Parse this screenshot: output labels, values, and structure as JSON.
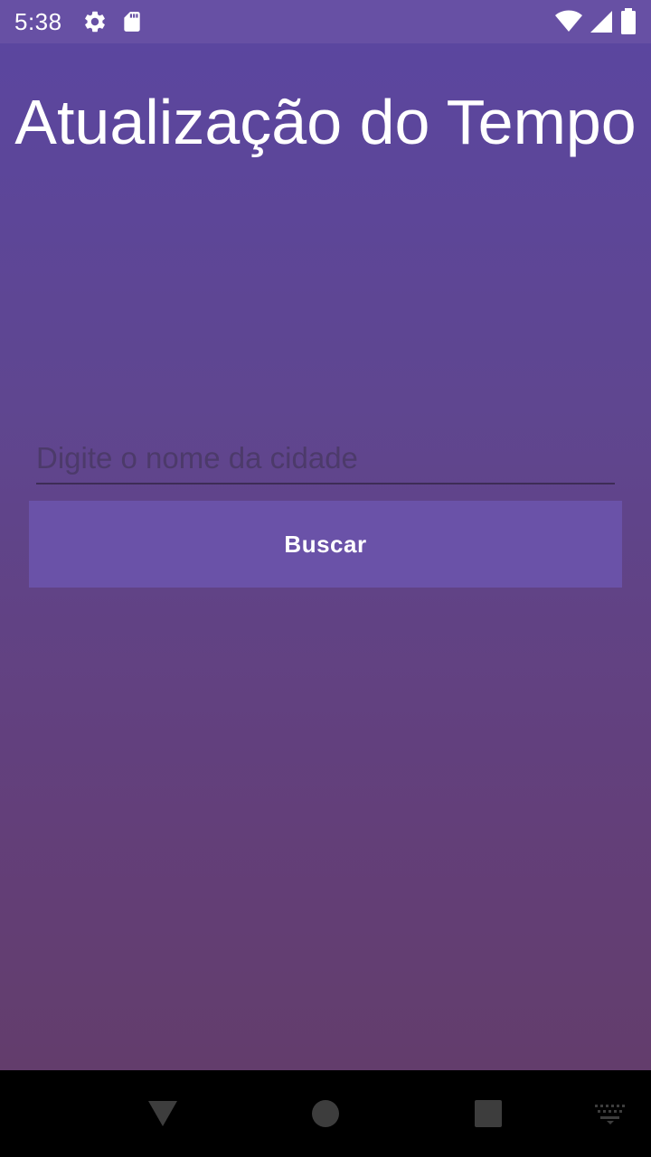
{
  "status_bar": {
    "time": "5:38",
    "left_icons": [
      "settings-icon",
      "sd-card-icon"
    ],
    "right_icons": [
      "wifi-icon",
      "signal-icon",
      "battery-icon"
    ]
  },
  "app": {
    "title": "Atualização do Tempo",
    "city_input": {
      "value": "",
      "placeholder": "Digite o nome da cidade"
    },
    "search_button_label": "Buscar"
  },
  "nav_bar": {
    "buttons": [
      "back-icon",
      "home-icon",
      "recents-icon",
      "keyboard-icon"
    ]
  },
  "colors": {
    "status_bar": "#6750a4",
    "button": "#6a52a8",
    "gradient_top": "#5b469f",
    "gradient_bottom": "#633d6c",
    "text": "#ffffff"
  }
}
